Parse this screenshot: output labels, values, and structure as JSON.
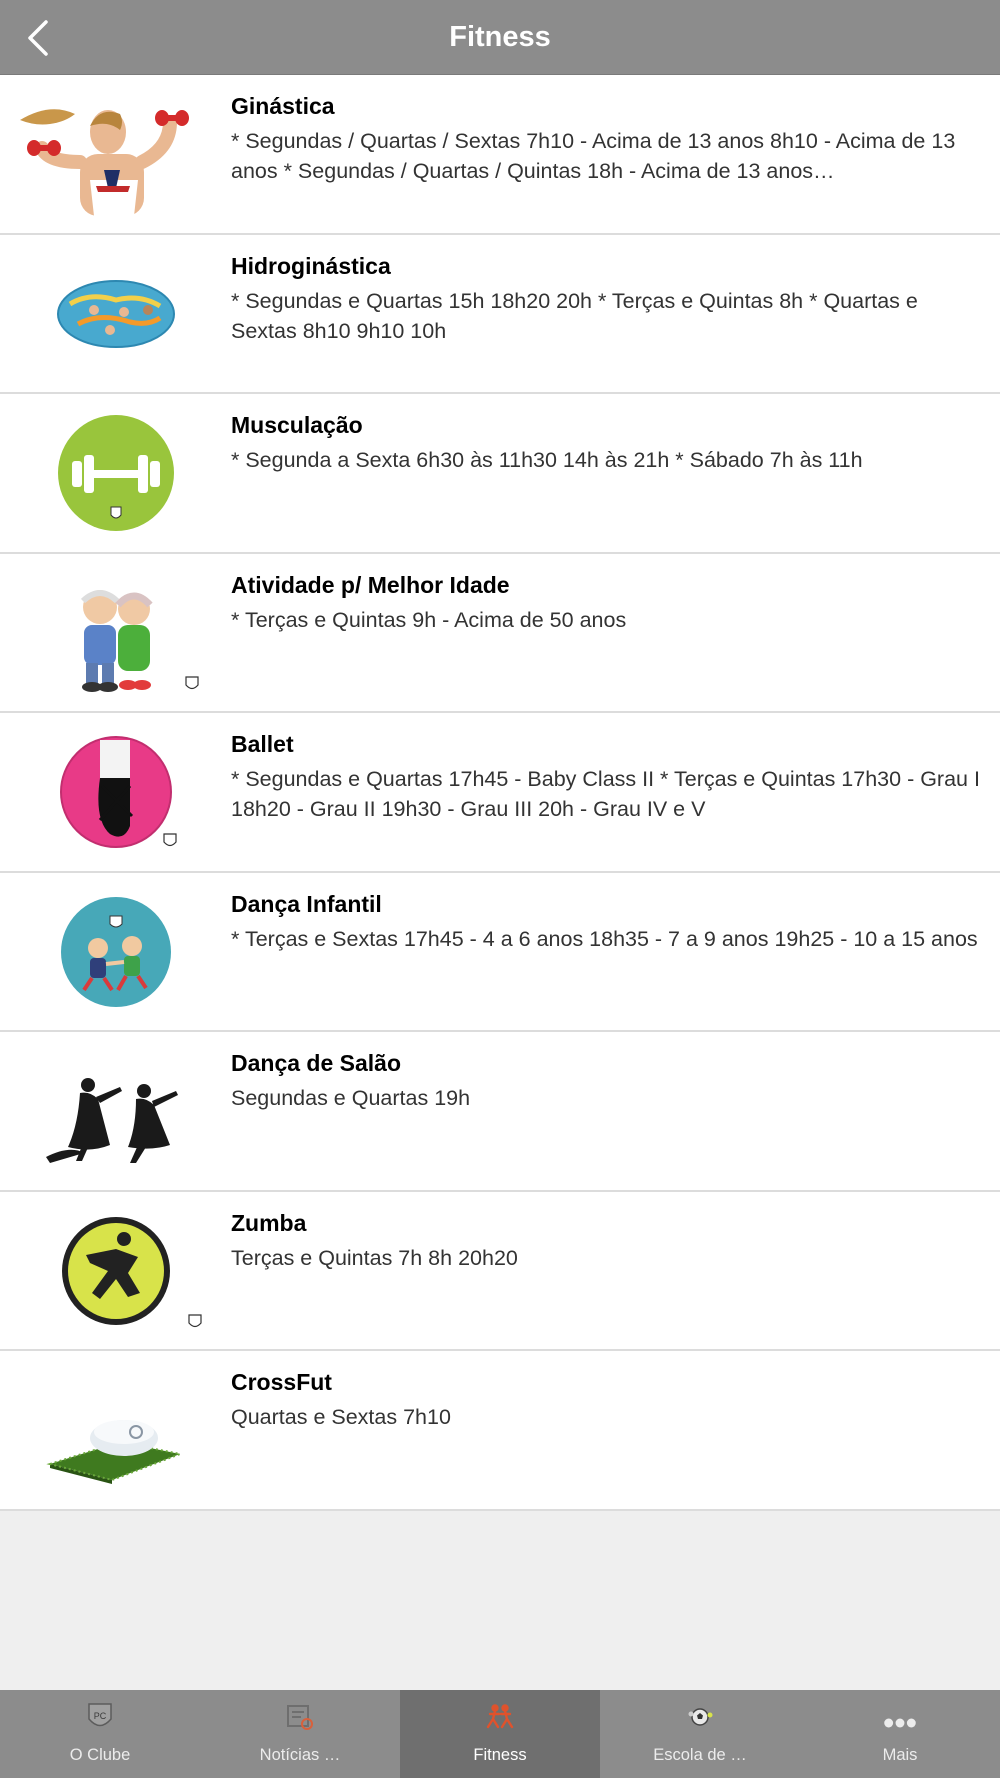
{
  "header": {
    "title": "Fitness"
  },
  "items": [
    {
      "title": "Ginástica",
      "desc": "* Segundas / Quartas / Sextas 7h10 - Acima de 13 anos 8h10 - Acima de 13 anos * Segundas / Quartas / Quintas 18h - Acima de 13 anos…"
    },
    {
      "title": "Hidroginástica",
      "desc": "* Segundas e Quartas 15h 18h20 20h * Terças e Quintas 8h * Quartas e Sextas 8h10 9h10 10h"
    },
    {
      "title": "Musculação",
      "desc": "* Segunda a Sexta 6h30 às 11h30 14h às 21h * Sábado 7h às 11h"
    },
    {
      "title": "Atividade p/ Melhor Idade",
      "desc": "* Terças e Quintas 9h - Acima de 50 anos"
    },
    {
      "title": "Ballet",
      "desc": "* Segundas e Quartas 17h45 - Baby Class II * Terças e Quintas 17h30 - Grau I 18h20 - Grau II 19h30 - Grau III 20h - Grau IV e V"
    },
    {
      "title": "Dança Infantil",
      "desc": "* Terças e Sextas 17h45 - 4 a 6 anos 18h35 - 7 a 9 anos 19h25 - 10 a 15 anos"
    },
    {
      "title": "Dança de Salão",
      "desc": "Segundas e Quartas 19h"
    },
    {
      "title": "Zumba",
      "desc": "Terças e Quintas 7h 8h 20h20"
    },
    {
      "title": "CrossFut",
      "desc": "Quartas e Sextas 7h10"
    }
  ],
  "tabbar": {
    "tabs": [
      {
        "label": "O Clube"
      },
      {
        "label": "Notícias …"
      },
      {
        "label": "Fitness"
      },
      {
        "label": "Escola de …"
      },
      {
        "label": "Mais"
      }
    ],
    "active_index": 2
  },
  "colors": {
    "header": "#8c8c8c",
    "active_tab": "#6f6f6f",
    "accent": "#e0522c"
  }
}
